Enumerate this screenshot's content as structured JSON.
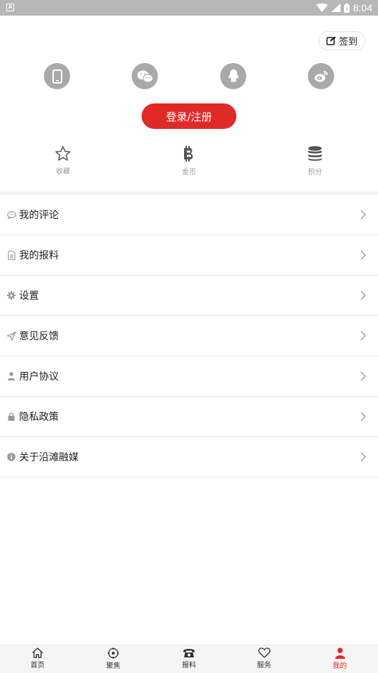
{
  "status_bar": {
    "time": "8:04"
  },
  "header": {
    "checkin_label": "签到",
    "login_label": "登录/注册"
  },
  "social_logins": [
    {
      "icon": "phone-icon"
    },
    {
      "icon": "wechat-icon"
    },
    {
      "icon": "qq-icon"
    },
    {
      "icon": "weibo-icon"
    }
  ],
  "stats": [
    {
      "label": "收藏",
      "icon": "star-icon"
    },
    {
      "label": "金币",
      "icon": "bitcoin-icon"
    },
    {
      "label": "积分",
      "icon": "database-icon"
    }
  ],
  "menu": [
    {
      "label": "我的评论",
      "icon": "comment-icon"
    },
    {
      "label": "我的报料",
      "icon": "document-icon"
    },
    {
      "label": "设置",
      "icon": "gear-icon"
    },
    {
      "label": "意见反馈",
      "icon": "send-icon"
    },
    {
      "label": "用户协议",
      "icon": "user-icon"
    },
    {
      "label": "隐私政策",
      "icon": "lock-icon"
    },
    {
      "label": "关于沿滩融媒",
      "icon": "info-icon"
    }
  ],
  "tabs": [
    {
      "label": "首页",
      "icon": "home-icon"
    },
    {
      "label": "聚焦",
      "icon": "focus-icon"
    },
    {
      "label": "报料",
      "icon": "telephone-icon"
    },
    {
      "label": "服务",
      "icon": "heart-icon"
    },
    {
      "label": "我的",
      "icon": "user-icon",
      "active": true
    }
  ],
  "colors": {
    "accent": "#e12a26",
    "social_icon_bg": "#a9a9a9",
    "status_bar": "#b7b7b7"
  }
}
